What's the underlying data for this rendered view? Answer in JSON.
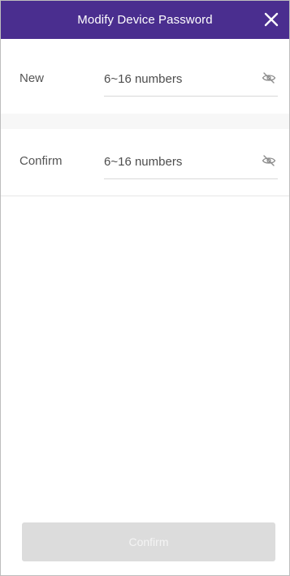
{
  "header": {
    "title": "Modify Device Password",
    "close_icon": "close-icon",
    "background_color": "#4a2e8f"
  },
  "form": {
    "new_password": {
      "label": "New",
      "placeholder": "6~16 numbers",
      "value": "",
      "visibility_icon": "eye-off-icon"
    },
    "confirm_password": {
      "label": "Confirm",
      "placeholder": "6~16 numbers",
      "value": "",
      "visibility_icon": "eye-off-icon"
    }
  },
  "footer": {
    "confirm_label": "Confirm",
    "confirm_disabled": true
  }
}
